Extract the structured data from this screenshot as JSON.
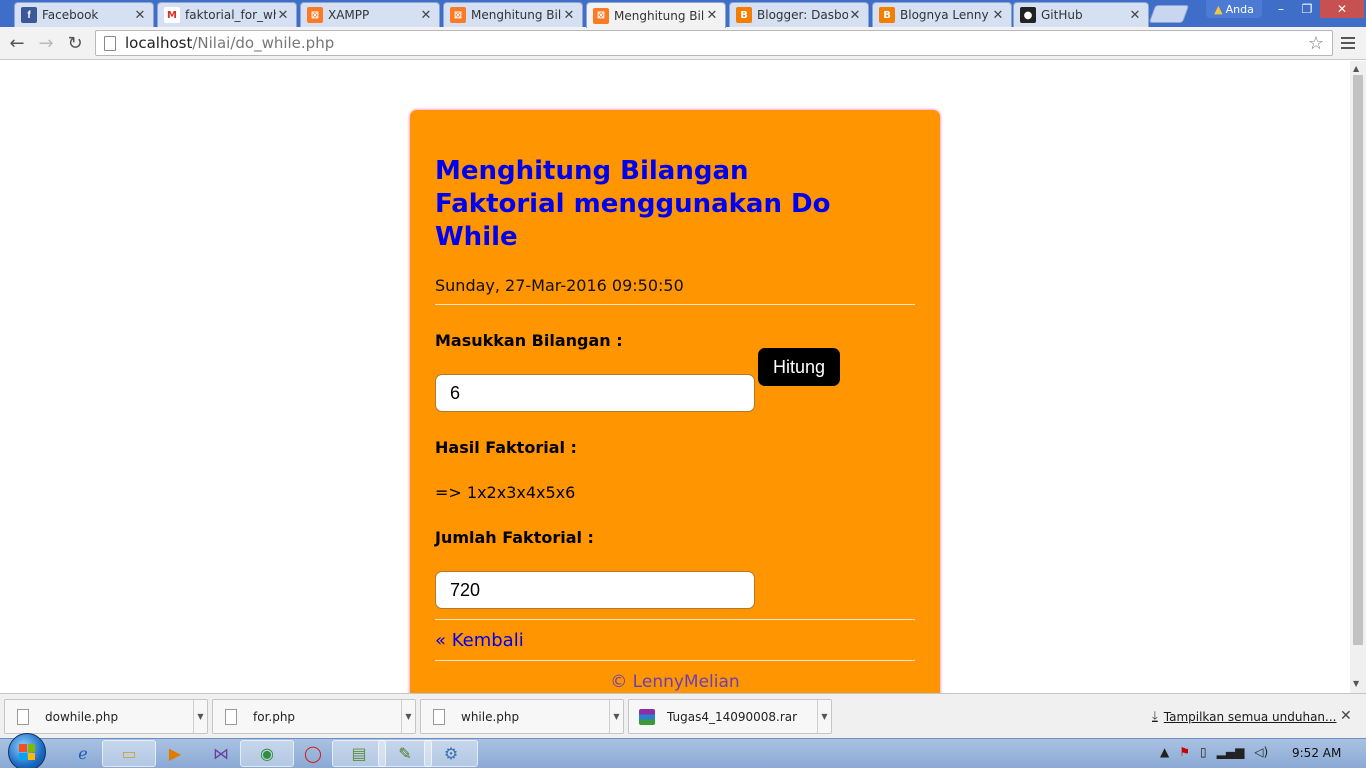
{
  "tabs": [
    {
      "label": "Facebook",
      "icon": "facebook-icon",
      "glyph": "f"
    },
    {
      "label": "faktorial_for_whi",
      "icon": "gmail-icon",
      "glyph": "M"
    },
    {
      "label": "XAMPP",
      "icon": "xampp-icon",
      "glyph": "⊠"
    },
    {
      "label": "Menghitung Bila",
      "icon": "xampp-icon",
      "glyph": "⊠"
    },
    {
      "label": "Menghitung Bila",
      "icon": "xampp-icon",
      "glyph": "⊠"
    },
    {
      "label": "Blogger: Dasbor",
      "icon": "blogger-icon",
      "glyph": "B"
    },
    {
      "label": "Blognya Lenny m",
      "icon": "blogger-icon",
      "glyph": "B"
    },
    {
      "label": "GitHub",
      "icon": "github-icon",
      "glyph": "●"
    }
  ],
  "active_tab_index": 4,
  "profile": {
    "label": "Anda"
  },
  "window_controls": {
    "minimize": "–",
    "restore": "❐",
    "close": "✕"
  },
  "address": {
    "host": "localhost",
    "path": "/Nilai/do_while.php"
  },
  "page": {
    "title": "Menghitung Bilangan Faktorial menggunakan Do While",
    "datetime": "Sunday, 27-Mar-2016 09:50:50",
    "input_label": "Masukkan Bilangan :",
    "input_value": "6",
    "button_label": "Hitung",
    "result_label": "Hasil Faktorial :",
    "result_value": "=> 1x2x3x4x5x6",
    "sum_label": "Jumlah Faktorial :",
    "sum_value": "720",
    "back_link": "« Kembali",
    "footer": "© LennyMelian"
  },
  "downloads": [
    {
      "name": "dowhile.php",
      "icon": "file-icon"
    },
    {
      "name": "for.php",
      "icon": "file-icon"
    },
    {
      "name": "while.php",
      "icon": "file-icon"
    },
    {
      "name": "Tugas4_14090008.rar",
      "icon": "winrar-icon"
    }
  ],
  "download_bar": {
    "show_all": "Tampilkan semua unduhan..."
  },
  "taskbar": {
    "clock": "9:52 AM"
  },
  "colors": {
    "card": "#ff9500",
    "heading": "#0000ee",
    "footer": "#6b3fb5",
    "button": "#000000"
  }
}
